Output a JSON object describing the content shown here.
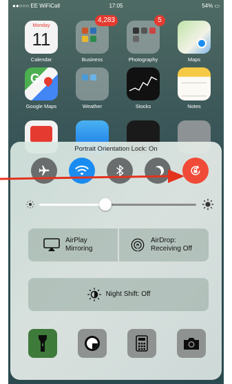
{
  "status_bar": {
    "carrier": "●●○○○ EE WiFiCall",
    "time": "17:05",
    "battery": "54%"
  },
  "home": {
    "apps": [
      {
        "label": "Calendar",
        "weekday": "Monday",
        "day": "11"
      },
      {
        "label": "Business",
        "badge": "4,283"
      },
      {
        "label": "Photography",
        "badge": "5"
      },
      {
        "label": "Maps"
      },
      {
        "label": "Google Maps"
      },
      {
        "label": "Weather"
      },
      {
        "label": "Stocks"
      },
      {
        "label": "Notes"
      }
    ]
  },
  "control_center": {
    "lock_status": "Portrait Orientation Lock: On",
    "toggles": [
      {
        "name": "airplane-mode",
        "state": "off"
      },
      {
        "name": "wifi",
        "state": "on"
      },
      {
        "name": "bluetooth",
        "state": "off"
      },
      {
        "name": "do-not-disturb",
        "state": "off"
      },
      {
        "name": "orientation-lock",
        "state": "on"
      }
    ],
    "brightness_fraction": 0.42,
    "airplay": {
      "line1": "AirPlay",
      "line2": "Mirroring"
    },
    "airdrop": {
      "line1": "AirDrop:",
      "line2": "Receiving Off"
    },
    "night_shift": "Night Shift: Off",
    "tools": [
      "flashlight",
      "timer",
      "calculator",
      "camera"
    ]
  },
  "colors": {
    "wifi_blue": "#1a8cf1",
    "lock_red": "#f04b38",
    "arrow_red": "#e4321e",
    "badge_red": "#e53a2f"
  }
}
